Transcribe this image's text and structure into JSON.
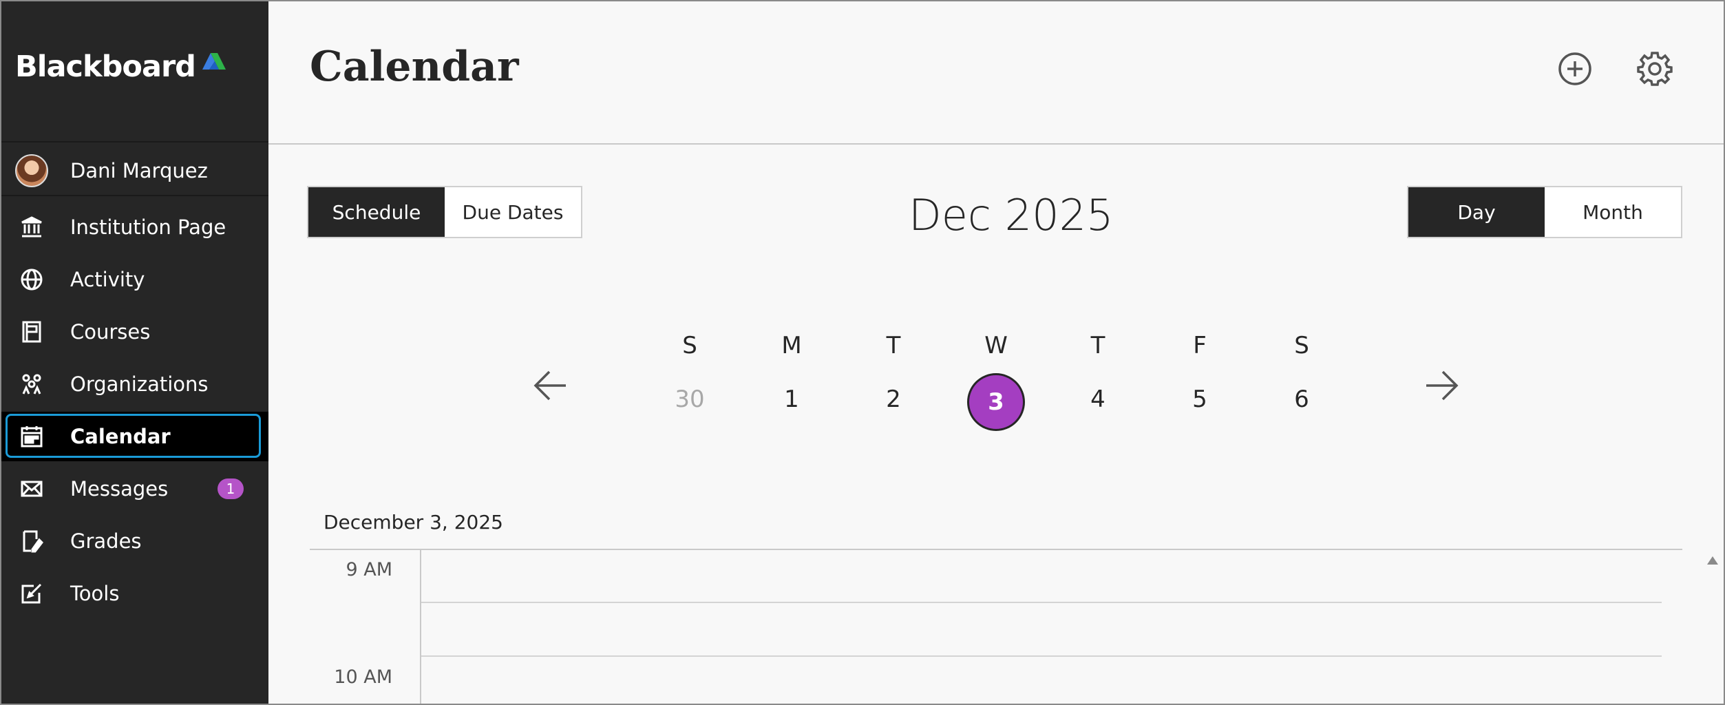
{
  "brand": {
    "name": "Blackboard"
  },
  "sidebar": {
    "user": {
      "name": "Dani Marquez"
    },
    "items": [
      {
        "label": "Institution Page",
        "icon": "institution-icon"
      },
      {
        "label": "Activity",
        "icon": "globe-icon"
      },
      {
        "label": "Courses",
        "icon": "book-icon"
      },
      {
        "label": "Organizations",
        "icon": "organizations-icon"
      },
      {
        "label": "Calendar",
        "icon": "calendar-icon",
        "active": true
      },
      {
        "label": "Messages",
        "icon": "envelope-icon",
        "badge": "1"
      },
      {
        "label": "Grades",
        "icon": "grades-icon"
      },
      {
        "label": "Tools",
        "icon": "tools-icon"
      }
    ]
  },
  "header": {
    "title": "Calendar",
    "add_icon": "add-circle-icon",
    "settings_icon": "gear-icon"
  },
  "view_toggle": {
    "schedule": "Schedule",
    "due_dates": "Due Dates",
    "selected": "Schedule"
  },
  "range_toggle": {
    "day": "Day",
    "month": "Month",
    "selected": "Day"
  },
  "month_title": "Dec 2025",
  "week": {
    "days": [
      "S",
      "M",
      "T",
      "W",
      "T",
      "F",
      "S"
    ],
    "dates": [
      "30",
      "1",
      "2",
      "3",
      "4",
      "5",
      "6"
    ],
    "selected_date": "3"
  },
  "schedule": {
    "date_heading": "December 3, 2025",
    "times": [
      "9 AM",
      "10 AM"
    ]
  },
  "colors": {
    "accent": "#a43ec1",
    "sidebar": "#262626",
    "focus_ring": "#1a9bd7",
    "badge": "#b554c8"
  }
}
